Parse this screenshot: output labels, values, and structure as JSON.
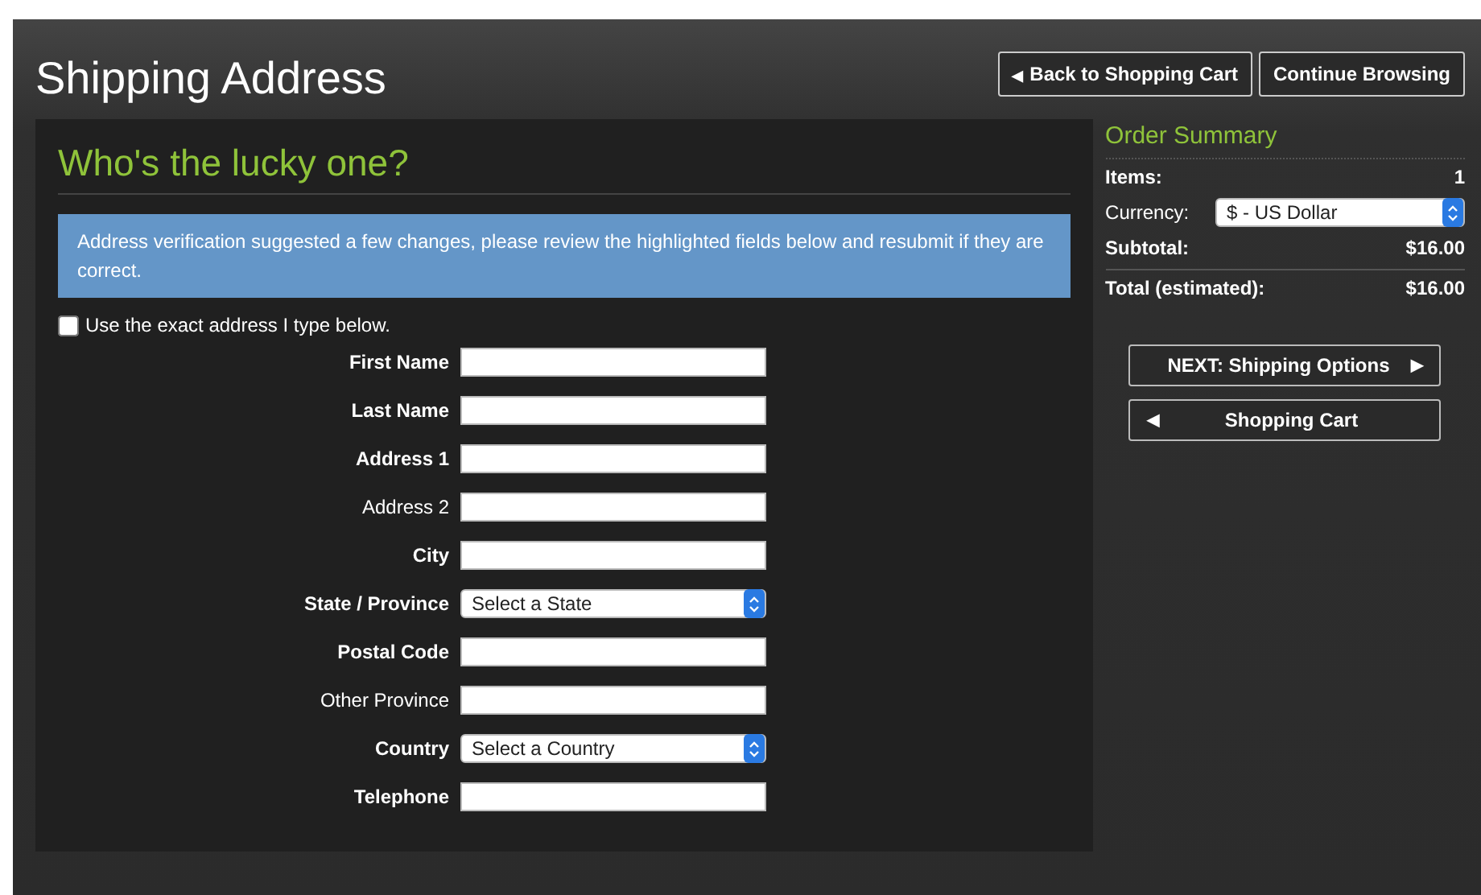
{
  "page_title": "Shipping Address",
  "header_buttons": [
    {
      "icon": "◀",
      "label": "Back to Shopping Cart"
    },
    {
      "label": "Continue Browsing"
    }
  ],
  "form": {
    "heading": "Who's the lucky one?",
    "alert": "Address verification suggested a few changes, please review the highlighted fields below and resubmit if they are correct.",
    "exact_address": {
      "label": "Use the exact address I type below.",
      "checked": false
    },
    "fields": [
      {
        "label": "First Name",
        "kind": "text",
        "required": true
      },
      {
        "label": "Last Name",
        "kind": "text",
        "required": true
      },
      {
        "label": "Address 1",
        "kind": "text",
        "required": true
      },
      {
        "label": "Address 2",
        "kind": "text",
        "required": false
      },
      {
        "label": "City",
        "kind": "text",
        "required": true
      },
      {
        "label": "State / Province",
        "kind": "select",
        "required": true,
        "value": "Select a State"
      },
      {
        "label": "Postal Code",
        "kind": "text",
        "required": true
      },
      {
        "label": "Other Province",
        "kind": "text",
        "required": false
      },
      {
        "label": "Country",
        "kind": "select",
        "required": true,
        "value": "Select a Country"
      },
      {
        "label": "Telephone",
        "kind": "text",
        "required": true
      }
    ]
  },
  "order_summary": {
    "title": "Order Summary",
    "rows": [
      {
        "label": "Items:",
        "kind": "text",
        "value": "1"
      },
      {
        "label": "Currency:",
        "kind": "select",
        "value": "$ - US Dollar"
      },
      {
        "label": "Subtotal:",
        "kind": "text",
        "value": "$16.00"
      },
      {
        "label": "Total (estimated):",
        "kind": "text",
        "value": "$16.00"
      }
    ],
    "buttons": [
      {
        "label": "NEXT: Shipping Options",
        "icon": "▶",
        "kind": "forward"
      },
      {
        "label": "Shopping Cart",
        "icon": "◀",
        "kind": "back"
      }
    ]
  }
}
